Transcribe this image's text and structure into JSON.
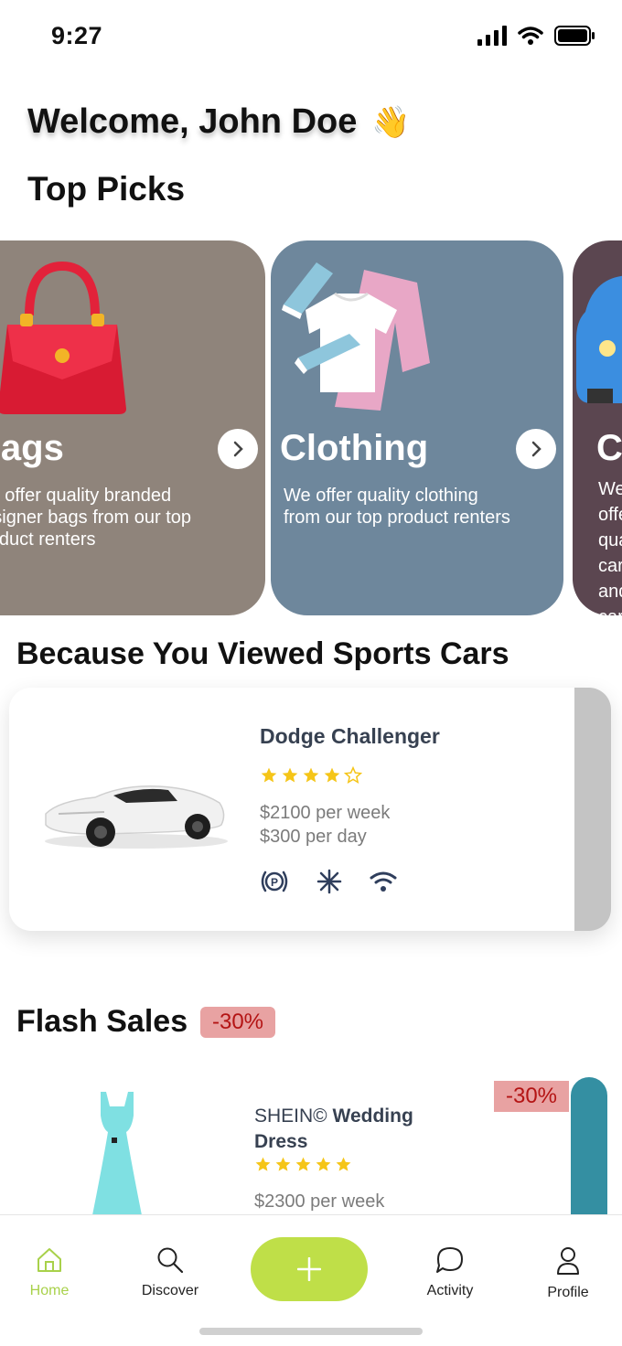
{
  "status_bar": {
    "time": "9:27"
  },
  "header": {
    "welcome": "Welcome, John Doe",
    "wave_emoji": "👋"
  },
  "top_picks": {
    "title": "Top Picks",
    "cards": [
      {
        "title": "Bags",
        "description": "We offer quality branded designer bags from our top product renters",
        "color": "#8f847b"
      },
      {
        "title": "Clothing",
        "description": "We offer quality clothing from our top product renters",
        "color": "#6e879c"
      },
      {
        "title": "Cars",
        "description": "We offer quality cars and car rentals from our pricing of our top renters who are",
        "color": "#5b4650"
      }
    ]
  },
  "viewed": {
    "title": "Because You Viewed Sports Cars",
    "item": {
      "name": "Dodge Challenger",
      "rating": 4,
      "max_rating": 5,
      "price_week": "$2100 per week",
      "price_day": "$300 per day",
      "amenities": [
        "parking-icon",
        "air-conditioning-icon",
        "wifi-icon"
      ]
    }
  },
  "flash_sales": {
    "title": "Flash Sales",
    "badge": "-30%",
    "item": {
      "brand": "SHEIN©",
      "name": "Wedding Dress",
      "rating": 5,
      "price_week": "$2300 per week",
      "badge": "-30%"
    }
  },
  "nav": {
    "items": [
      {
        "label": "Home",
        "icon": "home-icon",
        "active": true
      },
      {
        "label": "Discover",
        "icon": "search-icon",
        "active": false
      },
      {
        "label": "Activity",
        "icon": "chat-icon",
        "active": false
      },
      {
        "label": "Profile",
        "icon": "user-icon",
        "active": false
      }
    ],
    "add_label": "+"
  },
  "colors": {
    "accent": "#bfdf48",
    "active_nav": "#a8d14a",
    "star": "#f5c518",
    "discount": "#e8a2a2"
  }
}
